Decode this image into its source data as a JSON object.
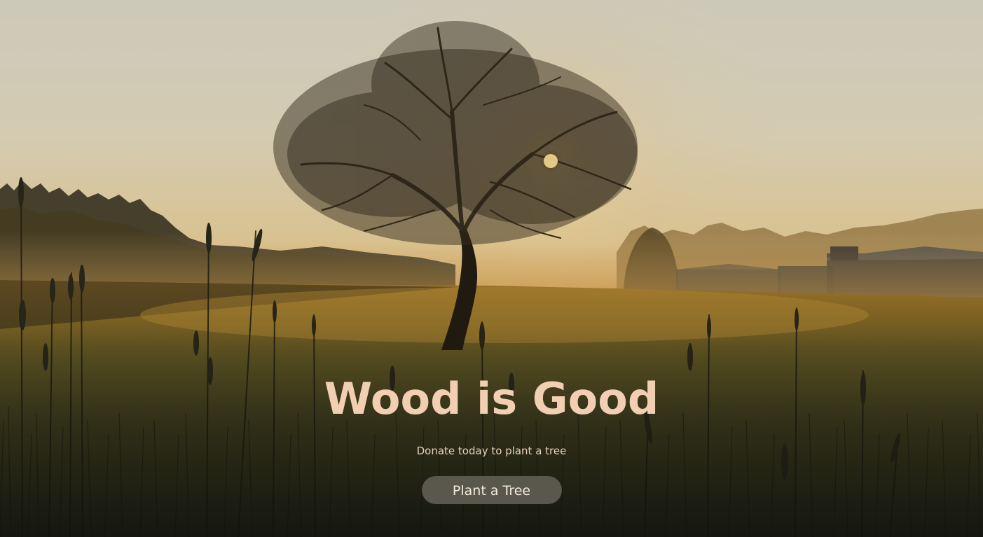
{
  "hero": {
    "title": "Wood is Good",
    "subtitle": "Donate today to plant a tree",
    "cta_label": "Plant a Tree"
  },
  "colors": {
    "title": "#f2cfb2",
    "subtitle": "#e8d2b8",
    "button_bg": "#5f5d52",
    "button_text": "#f3eadb"
  },
  "background": {
    "description_icon": "sunrise-meadow-tree-photo"
  }
}
